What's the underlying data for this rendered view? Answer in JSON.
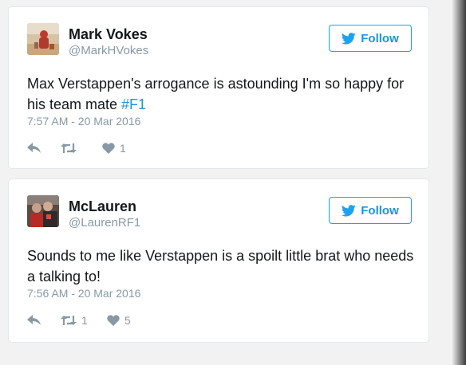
{
  "colors": {
    "twitter_blue": "#1da1f2",
    "link_blue": "#1b95e0",
    "text_primary": "#14171a",
    "text_secondary": "#8899a6",
    "card_border": "#e1e8ed"
  },
  "tweets": [
    {
      "author_name": "Mark Vokes",
      "author_handle": "@MarkHVokes",
      "follow_label": "Follow",
      "text_before": "Max Verstappen's arrogance is astounding I'm so happy for his team mate ",
      "hashtag": "#F1",
      "timestamp": "7:57 AM - 20 Mar 2016",
      "retweets": "",
      "likes": "1",
      "icons": [
        "reply-icon",
        "retweet-icon",
        "heart-icon"
      ]
    },
    {
      "author_name": "McLauren",
      "author_handle": "@LaurenRF1",
      "follow_label": "Follow",
      "text_before": "Sounds to me like Verstappen is a spoilt little brat who needs a talking to!",
      "hashtag": "",
      "timestamp": "7:56 AM - 20 Mar 2016",
      "retweets": "1",
      "likes": "5",
      "icons": [
        "reply-icon",
        "retweet-icon",
        "heart-icon"
      ]
    }
  ]
}
